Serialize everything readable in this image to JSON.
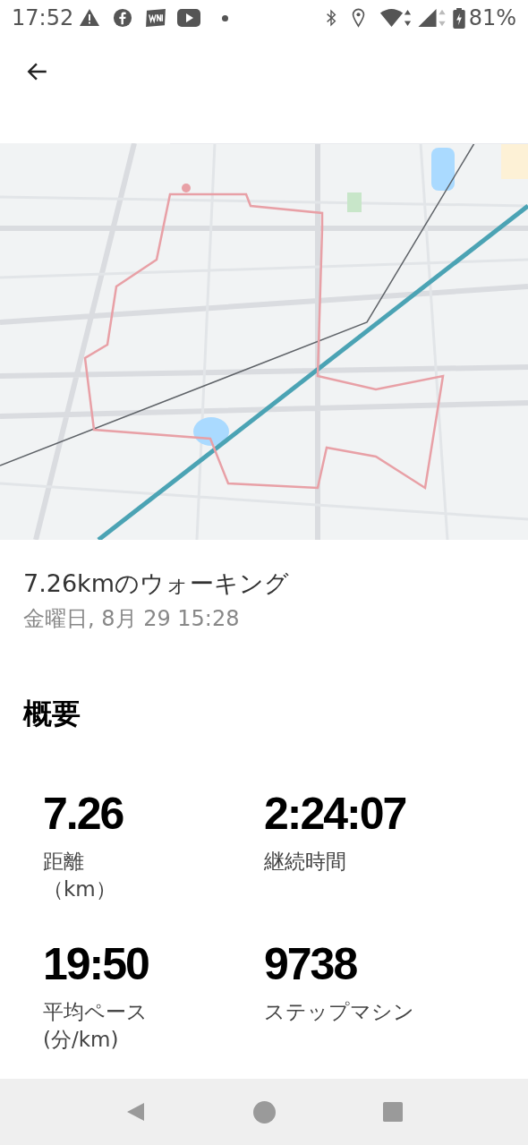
{
  "status_bar": {
    "time": "17:52",
    "battery": "81%"
  },
  "activity": {
    "title": "7.26kmのウォーキング",
    "date": "金曜日, 8月 29 15:28"
  },
  "summary": {
    "heading": "概要",
    "stats": [
      {
        "value": "7.26",
        "label": "距離",
        "unit": "（km）"
      },
      {
        "value": "2:24:07",
        "label": "継続時間"
      },
      {
        "value": "19:50",
        "label": "平均ペース",
        "unit": "(分/km)"
      },
      {
        "value": "9738",
        "label": "ステップマシン"
      }
    ]
  }
}
